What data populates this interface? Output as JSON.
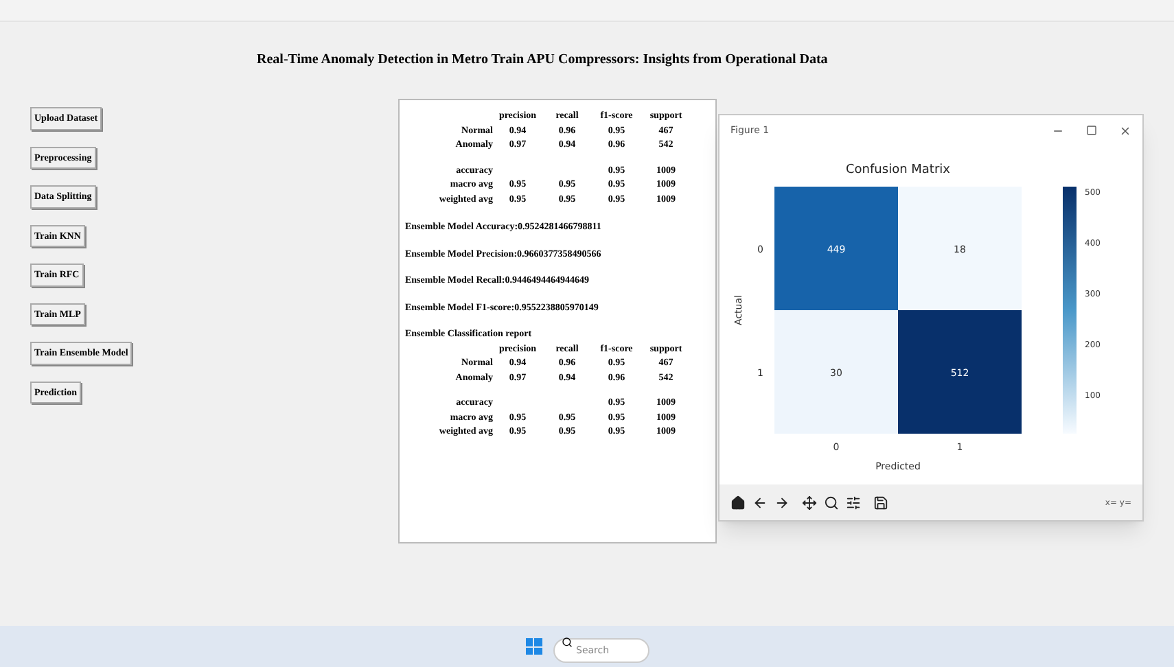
{
  "header": {
    "title": "Real-Time Anomaly Detection in Metro Train APU Compressors: Insights from Operational Data"
  },
  "buttons": [
    "Upload Dataset",
    "Preprocessing",
    "Data Splitting",
    "Train KNN",
    "Train RFC",
    "Train MLP",
    "Train Ensemble Model",
    "Prediction"
  ],
  "output": {
    "blocks": [
      {
        "kind": "report",
        "columns": [
          "precision",
          "recall",
          "f1-score",
          "support"
        ],
        "rows": [
          {
            "label": "Normal",
            "cells": [
              "0.94",
              "0.96",
              "0.95",
              "467"
            ]
          },
          {
            "label": "Anomaly",
            "cells": [
              "0.97",
              "0.94",
              "0.96",
              "542"
            ]
          },
          {
            "kind": "gap"
          },
          {
            "label": "accuracy",
            "cells": [
              "",
              "",
              "0.95",
              "1009"
            ]
          },
          {
            "label": "macro avg",
            "cells": [
              "0.95",
              "0.95",
              "0.95",
              "1009"
            ]
          },
          {
            "label": "weighted avg",
            "cells": [
              "0.95",
              "0.95",
              "0.95",
              "1009"
            ]
          }
        ]
      },
      {
        "kind": "line",
        "text": "Ensemble Model Accuracy:0.9524281466798811"
      },
      {
        "kind": "line",
        "text": "Ensemble Model Precision:0.9660377358490566"
      },
      {
        "kind": "line",
        "text": "Ensemble Model Recall:0.9446494464944649"
      },
      {
        "kind": "line",
        "text": "Ensemble Model F1-score:0.9552238805970149"
      },
      {
        "kind": "heading",
        "text": "Ensemble Classification report"
      },
      {
        "kind": "report",
        "columns": [
          "precision",
          "recall",
          "f1-score",
          "support"
        ],
        "rows": [
          {
            "label": "Normal",
            "cells": [
              "0.94",
              "0.96",
              "0.95",
              "467"
            ]
          },
          {
            "label": "Anomaly",
            "cells": [
              "0.97",
              "0.94",
              "0.96",
              "542"
            ]
          },
          {
            "kind": "gap"
          },
          {
            "label": "accuracy",
            "cells": [
              "",
              "",
              "0.95",
              "1009"
            ]
          },
          {
            "label": "macro avg",
            "cells": [
              "0.95",
              "0.95",
              "0.95",
              "1009"
            ]
          },
          {
            "label": "weighted avg",
            "cells": [
              "0.95",
              "0.95",
              "0.95",
              "1009"
            ]
          }
        ]
      }
    ]
  },
  "figure": {
    "title": "Figure 1",
    "plot_title": "Confusion Matrix",
    "ylabel": "Actual",
    "xlabel": "Predicted",
    "row_labels": [
      "0",
      "1"
    ],
    "col_labels": [
      "0",
      "1"
    ],
    "cells": [
      {
        "text": "449",
        "color": "#1763aa"
      },
      {
        "text": "18",
        "color": "#f2f8fd"
      },
      {
        "text": "30",
        "color": "#eef5fc"
      },
      {
        "text": "512",
        "color": "#08306b"
      }
    ],
    "colorbar_ticks": [
      "500",
      "400",
      "300",
      "200",
      "100"
    ],
    "coords": "x= y="
  },
  "taskbar": {
    "search": {
      "placeholder": "Search"
    }
  }
}
